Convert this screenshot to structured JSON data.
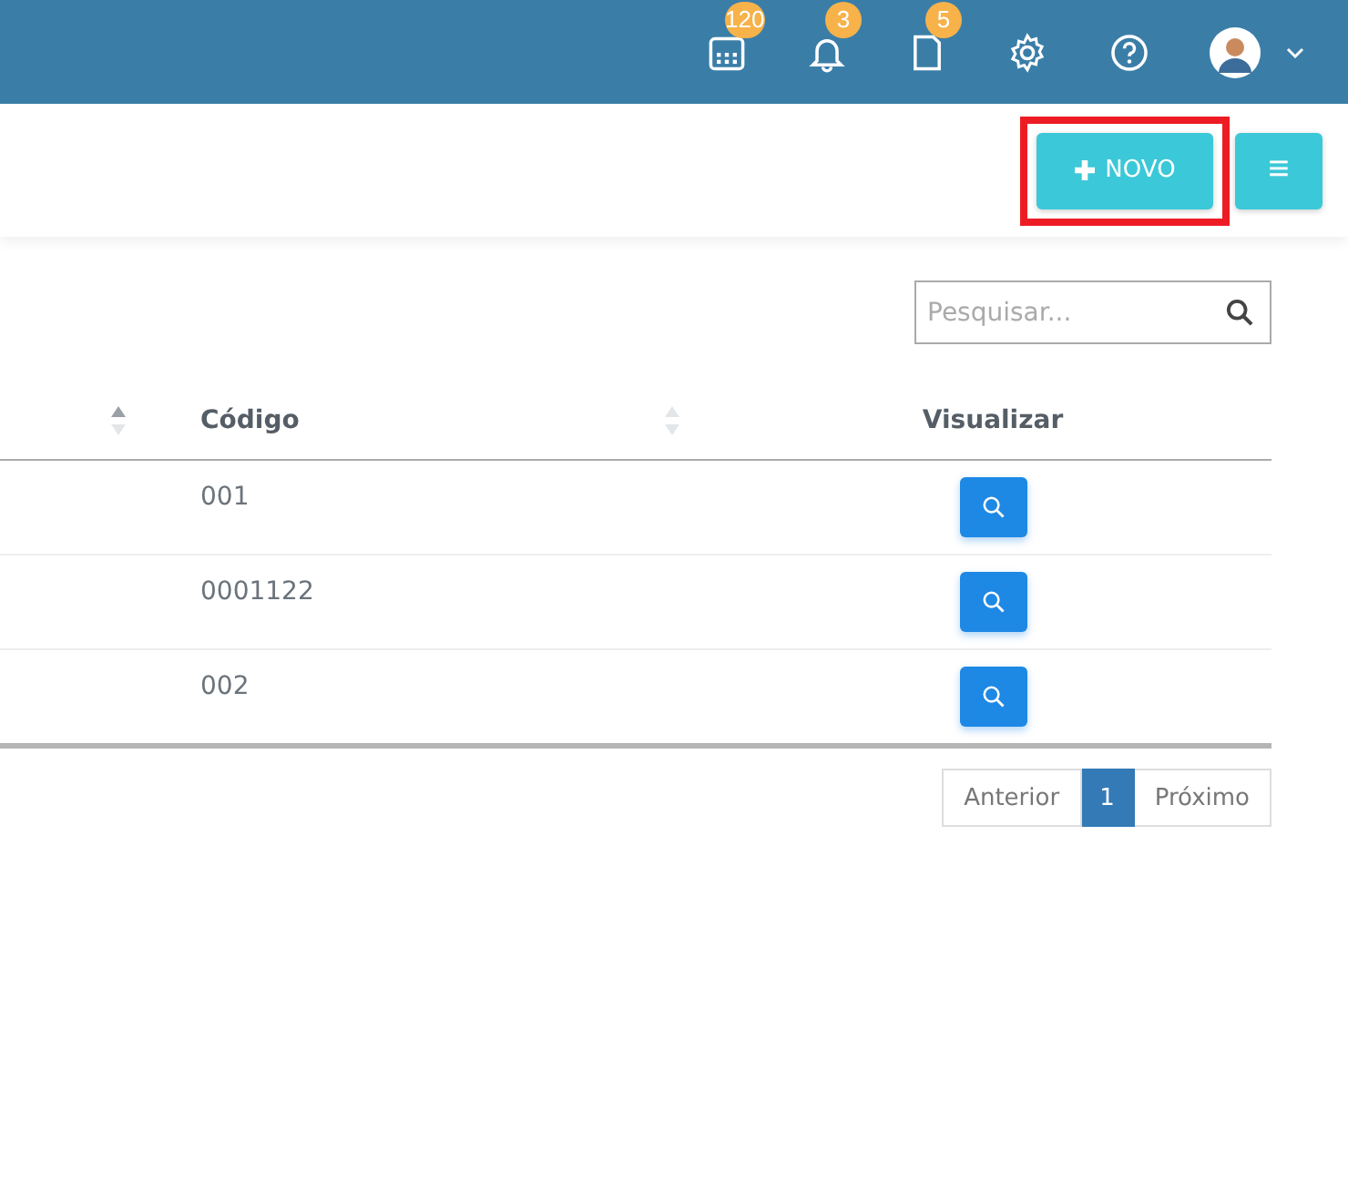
{
  "topbar": {
    "badges": [
      {
        "kind": "calendar",
        "count": "120"
      },
      {
        "kind": "bell",
        "count": "3"
      },
      {
        "kind": "document",
        "count": "5"
      }
    ],
    "icons": [
      {
        "kind": "settings"
      },
      {
        "kind": "help"
      }
    ],
    "user": {
      "kind": "avatar"
    }
  },
  "toolbar": {
    "new_button": {
      "label": "NOVO",
      "highlighted": true
    },
    "menu_button": {
      "label": "≡"
    }
  },
  "search": {
    "placeholder": "Pesquisar..."
  },
  "table": {
    "columns": [
      {
        "sortable": true,
        "sort_active": true
      },
      {
        "label": "Código",
        "sortable": true,
        "sort_active": false
      },
      {
        "label": "Visualizar"
      }
    ],
    "rows": [
      {
        "codigo": "001"
      },
      {
        "codigo": "0001122"
      },
      {
        "codigo": "002"
      }
    ]
  },
  "pagination": {
    "previous": "Anterior",
    "pages": [
      {
        "label": "1",
        "selected": true
      }
    ],
    "next": "Próximo"
  }
}
